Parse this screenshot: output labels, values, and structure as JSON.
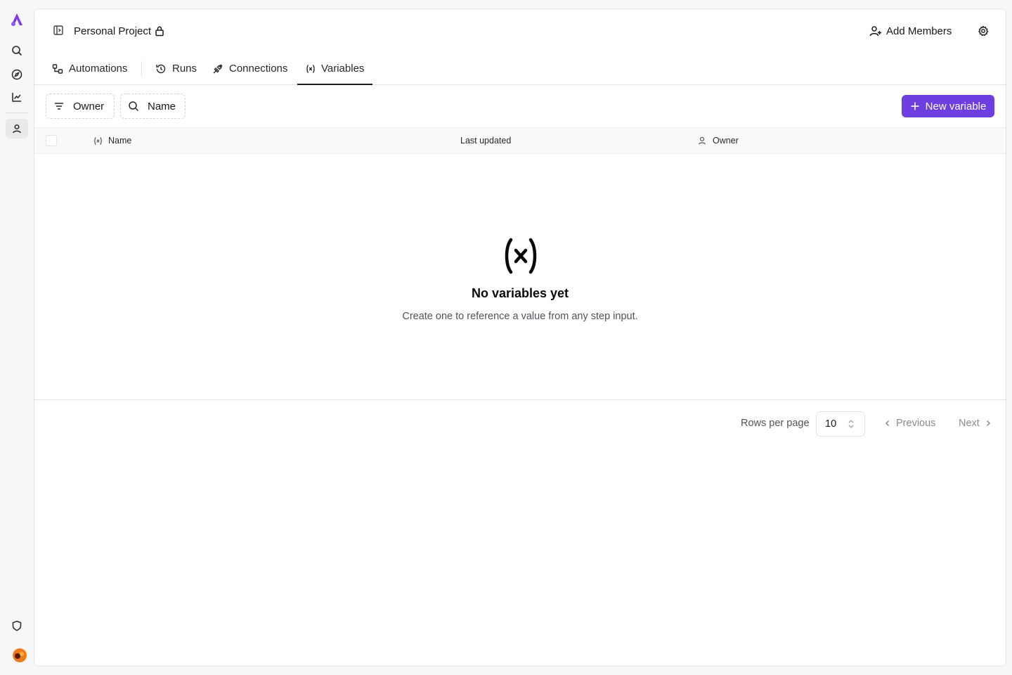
{
  "project": {
    "title": "Personal Project"
  },
  "header": {
    "add_members_label": "Add Members"
  },
  "tabs": [
    {
      "label": "Automations",
      "icon": "flow-icon",
      "active": false
    },
    {
      "label": "Runs",
      "icon": "history-icon",
      "active": false
    },
    {
      "label": "Connections",
      "icon": "plug-icon",
      "active": false
    },
    {
      "label": "Variables",
      "icon": "variable-icon",
      "active": true
    }
  ],
  "toolbar": {
    "owner_filter_label": "Owner",
    "name_filter_label": "Name",
    "new_variable_label": "New variable"
  },
  "table": {
    "columns": [
      "Name",
      "Last updated",
      "Owner"
    ]
  },
  "empty_state": {
    "title": "No variables yet",
    "description": "Create one to reference a value from any step input."
  },
  "pagination": {
    "rows_label": "Rows per page",
    "rows_value": "10",
    "previous_label": "Previous",
    "next_label": "Next"
  },
  "colors": {
    "accent": "#6e3ee0",
    "avatar": "#f07a1a"
  }
}
